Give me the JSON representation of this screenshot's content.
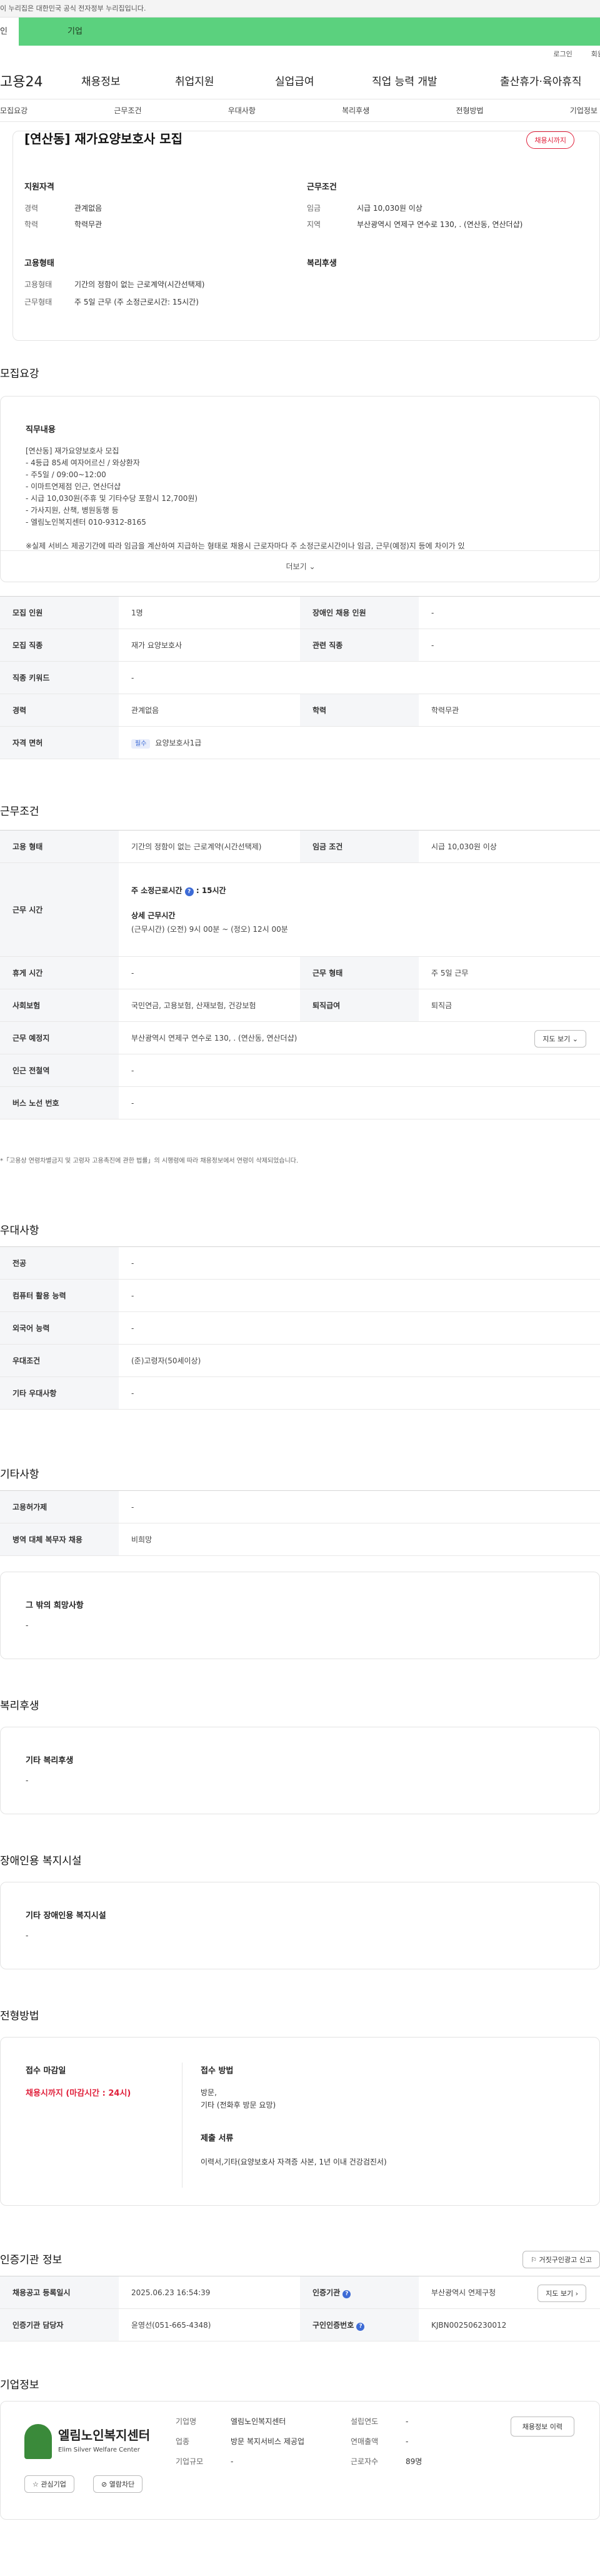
{
  "gov_bar": "이 누리집은 대한민국 공식 전자정부 누리집입니다.",
  "tabs": [
    "인",
    "기업"
  ],
  "top_links": [
    "로그인",
    "회원"
  ],
  "logo": "고용24",
  "gnb": [
    "채용정보",
    "취업지원",
    "실업급여",
    "직업 능력 개발",
    "출산휴가·육아휴직"
  ],
  "subnav": [
    "모집요강",
    "근무조건",
    "우대사항",
    "복리후생",
    "전형방법",
    "기업정보"
  ],
  "header_card": {
    "title": "[연산동] 재가요양보호사 모집",
    "badge": "채용시까지",
    "left_head": "지원자격",
    "left_rows": [
      [
        "경력",
        "관계없음"
      ],
      [
        "학력",
        "학력무관"
      ]
    ],
    "right_head": "근무조건",
    "right_rows": [
      [
        "임금",
        "시급 10,030원 이상"
      ],
      [
        "지역",
        "부산광역시 연제구 연수로 130, . (연산동, 연산더샵)"
      ]
    ],
    "type_head": "고용형태",
    "type_rows": [
      [
        "고용형태",
        "기간의 정함이 없는 근로계약(시간선택제)"
      ],
      [
        "근무형태",
        "주 5일 근무 (주 소정근로시간: 15시간)"
      ]
    ],
    "welfare_head": "복리후생"
  },
  "recruit": {
    "title": "모집요강",
    "job_head": "직무내용",
    "job_lines": [
      "[연산동] 재가요양보호사 모집",
      "- 4등급 85세 여자어르신 / 와상환자",
      "- 주5일 / 09:00~12:00",
      "- 이마트연제점 인근, 연산더샵",
      "- 시급 10,030원(주휴 및 기타수당 포함시 12,700원)",
      "- 가사지원, 산책, 병원동행 등",
      "- 엘림노인복지센터 010-9312-8165",
      "",
      "※실제 서비스 제공기간에 따라 임금을 계산하여 지급하는 형태로 채용시 근로자마다 주 소정근로시간이나 임금, 근무(예정)지 등에 차이가 있"
    ],
    "more": "더보기",
    "rows": [
      [
        "모집 인원",
        "1명",
        "장애인 채용 인원",
        "-"
      ],
      [
        "모집 직종",
        "재가 요양보호사",
        "관련 직종",
        "-"
      ],
      [
        "직종 키워드",
        "-",
        "",
        ""
      ],
      [
        "경력",
        "관계없음",
        "학력",
        "학력무관"
      ]
    ],
    "license_head": "자격 면허",
    "license_tag": "필수",
    "license_val": "요양보호사1급"
  },
  "conditions": {
    "title": "근무조건",
    "emp_type_h": "고용 형태",
    "emp_type_v": "기간의 정함이 없는 근로계약(시간선택제)",
    "wage_h": "임금 조건",
    "wage_v": "시급 10,030원 이상",
    "hours_h": "근무 시간",
    "hours_total_label": "주 소정근로시간",
    "hours_total": ": 15시간",
    "hours_detail_label": "상세 근무시간",
    "hours_detail": "(근무시간) (오전) 9시 00분 ~ (정오) 12시 00분",
    "rest_h": "휴게 시간",
    "rest_v": "-",
    "worktype_h": "근무 형태",
    "worktype_v": "주 5일 근무",
    "insurance_h": "사회보험",
    "insurance_v": "국민연금, 고용보험, 산재보험, 건강보험",
    "retire_h": "퇴직급여",
    "retire_v": "퇴직금",
    "place_h": "근무 예정지",
    "place_v": "부산광역시 연제구 연수로 130, . (연산동, 연산더샵)",
    "map_btn": "지도 보기",
    "subway_h": "인근 전철역",
    "subway_v": "-",
    "bus_h": "버스 노선 번호",
    "bus_v": "-",
    "note": "*「고용상 연령차별금지 및 고령자 고용촉진에 관한 법률」의 시행령에 따라 채용정보에서 연령이 삭제되었습니다."
  },
  "prefer": {
    "title": "우대사항",
    "rows": [
      [
        "전공",
        "-"
      ],
      [
        "컴퓨터 활용 능력",
        "-"
      ],
      [
        "외국어 능력",
        "-"
      ],
      [
        "우대조건",
        "(준)고령자(50세이상)"
      ],
      [
        "기타 우대사항",
        "-"
      ]
    ]
  },
  "etc": {
    "title": "기타사항",
    "rows": [
      [
        "고용허가제",
        "-"
      ],
      [
        "병역 대체 복무자 채용",
        "비희망"
      ]
    ],
    "other_head": "그 밖의 희망사항",
    "other_val": "-"
  },
  "welfare": {
    "title": "복리후생",
    "head": "기타 복리후생",
    "val": "-"
  },
  "disabled": {
    "title": "장애인용 복지시설",
    "head": "기타 장애인용 복지시설",
    "val": "-"
  },
  "process": {
    "title": "전형방법",
    "deadline_head": "접수 마감일",
    "deadline_val": "채용시까지 (마감시간 : 24시)",
    "method_head": "접수 방법",
    "method_lines": [
      "방문,",
      "기타 (전화후 방문 요망)"
    ],
    "docs_head": "제출 서류",
    "docs_val": "이력서,기타(요양보호사 자격증 사본, 1년 이내 건강검진서)"
  },
  "agency": {
    "title": "인증기관 정보",
    "report_btn": "거짓구인광고 신고",
    "reg_h": "채용공고 등록일시",
    "reg_v": "2025.06.23 16:54:39",
    "agency_h": "인증기관",
    "agency_v": "부산광역시 연제구청",
    "map_btn": "지도 보기",
    "manager_h": "인증기관 담당자",
    "manager_v": "윤영선(051-665-4348)",
    "num_h": "구인인증번호",
    "num_v": "KJBN002506230012"
  },
  "company": {
    "title": "기업정보",
    "logo_ko": "엘림노인복지센터",
    "logo_en": "Elim Silver Welfare Center",
    "fav_btn": "관심기업",
    "block_btn": "열람차단",
    "rows": [
      [
        "기업명",
        "엘림노인복지센터"
      ],
      [
        "업종",
        "방문 복지서비스 제공업"
      ],
      [
        "기업규모",
        "-"
      ]
    ],
    "rows2": [
      [
        "설립연도",
        "-"
      ],
      [
        "연매출액",
        "-"
      ],
      [
        "근로자수",
        "89명"
      ]
    ],
    "history_btn": "채용정보 이력"
  },
  "colors": {
    "green": "#5bd17e",
    "red": "#e0203b",
    "blue": "#3d6bd6"
  }
}
